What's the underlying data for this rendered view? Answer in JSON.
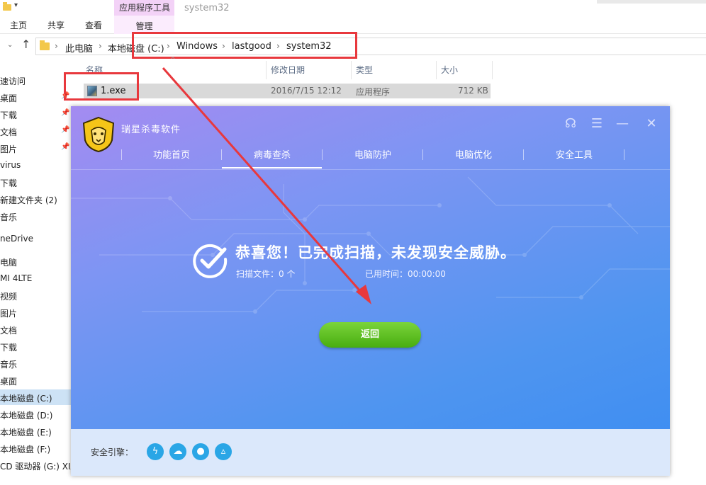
{
  "explorer": {
    "context_tab_group": "应用程序工具",
    "title": "system32",
    "tabs": [
      "主页",
      "共享",
      "查看"
    ],
    "manage_tab": "管理",
    "breadcrumb": [
      "此电脑",
      "本地磁盘 (C:)",
      "Windows",
      "lastgood",
      "system32"
    ],
    "columns": [
      "名称",
      "修改日期",
      "类型",
      "大小"
    ],
    "files": [
      {
        "name": "1.exe",
        "date": "2016/7/15 12:12",
        "type": "应用程序",
        "size": "712 KB"
      }
    ],
    "nav_items": [
      {
        "label": "速访问",
        "pinned": false
      },
      {
        "label": "桌面",
        "pinned": true
      },
      {
        "label": "下载",
        "pinned": true
      },
      {
        "label": "文档",
        "pinned": true
      },
      {
        "label": "图片",
        "pinned": true
      },
      {
        "label": "virus",
        "pinned": false
      },
      {
        "label": "下载",
        "pinned": false
      },
      {
        "label": "新建文件夹 (2)",
        "pinned": false
      },
      {
        "label": "音乐",
        "pinned": false
      },
      {
        "label": "neDrive",
        "pinned": false
      },
      {
        "label": "电脑",
        "pinned": false
      },
      {
        "label": "MI 4LTE",
        "pinned": false
      },
      {
        "label": "视频",
        "pinned": false
      },
      {
        "label": "图片",
        "pinned": false
      },
      {
        "label": "文档",
        "pinned": false
      },
      {
        "label": "下载",
        "pinned": false
      },
      {
        "label": "音乐",
        "pinned": false
      },
      {
        "label": "桌面",
        "pinned": false
      },
      {
        "label": "本地磁盘 (C:)",
        "pinned": false,
        "selected": true
      },
      {
        "label": "本地磁盘 (D:)",
        "pinned": false
      },
      {
        "label": "本地磁盘 (E:)",
        "pinned": false
      },
      {
        "label": "本地磁盘 (F:)",
        "pinned": false
      },
      {
        "label": "CD 驱动器 (G:) XIA",
        "pinned": false
      }
    ]
  },
  "antivirus": {
    "title": "瑞星杀毒软件",
    "tabs": [
      "功能首页",
      "病毒查杀",
      "电脑防护",
      "电脑优化",
      "安全工具"
    ],
    "active_tab": "病毒查杀",
    "result_title": "恭喜您！已完成扫描，未发现安全威胁。",
    "scanned_files": "扫描文件：0 个",
    "elapsed_time": "已用时间：00:00:00",
    "back_button": "返回",
    "engine_label": "安全引擎：",
    "engine_icons": [
      "lightning-icon",
      "cloud-icon",
      "user-icon",
      "triangle-icon"
    ],
    "colors": {
      "accent_green": "#5cc024",
      "window_blue": "#4f95f0",
      "window_purple": "#a48bf1",
      "annotation_red": "#e8383d"
    }
  }
}
